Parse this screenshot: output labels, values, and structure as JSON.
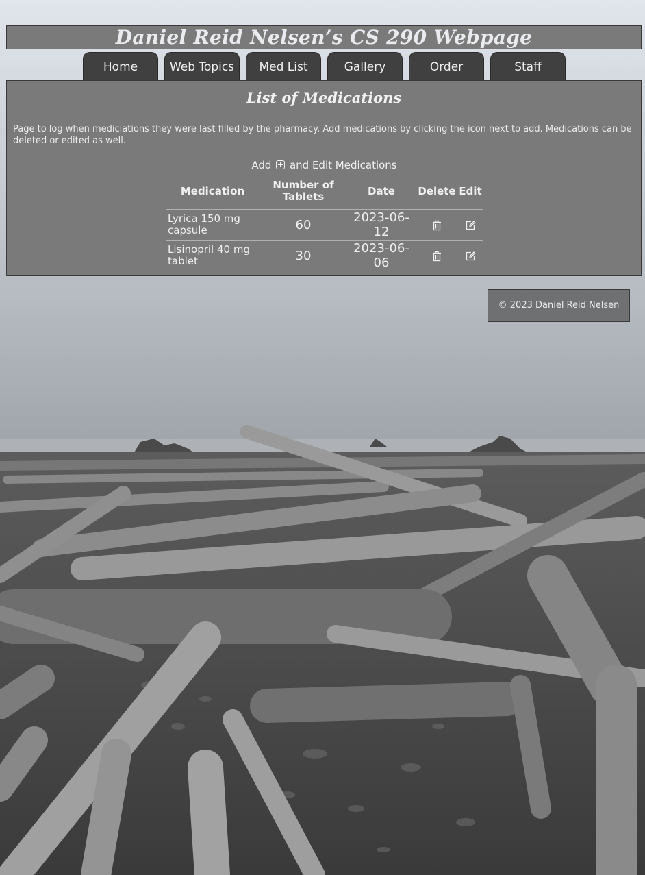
{
  "header": {
    "title": "Daniel Reid Nelsen’s CS 290 Webpage"
  },
  "nav": {
    "tabs": [
      {
        "label": "Home"
      },
      {
        "label": "Web Topics"
      },
      {
        "label": "Med List"
      },
      {
        "label": "Gallery"
      },
      {
        "label": "Order"
      },
      {
        "label": "Staff"
      }
    ]
  },
  "main": {
    "heading": "List of Medications",
    "description": "Page to log when mediciations they were last filled by the pharmacy. Add medications by clicking the icon next to add. Medications can be deleted or edited as well.",
    "table": {
      "caption_prefix": "Add",
      "caption_suffix": "and Edit Medications",
      "headers": {
        "medication": "Medication",
        "tablets": "Number of Tablets",
        "date": "Date",
        "delete": "Delete",
        "edit": "Edit"
      },
      "rows": [
        {
          "medication": "Lyrica 150 mg capsule",
          "tablets": "60",
          "date": "2023-06-12"
        },
        {
          "medication": "Lisinopril 40 mg tablet",
          "tablets": "30",
          "date": "2023-06-06"
        }
      ],
      "icons": {
        "add": "plus-square-icon",
        "delete": "trash-icon",
        "edit": "edit-icon"
      }
    }
  },
  "footer": {
    "text": "© 2023 Daniel Reid Nelsen"
  }
}
